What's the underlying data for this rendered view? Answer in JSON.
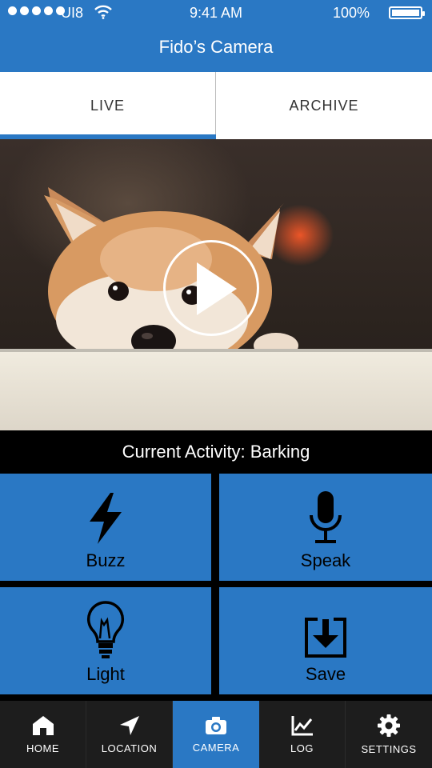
{
  "status": {
    "carrier": "UI8",
    "time": "9:41 AM",
    "battery_pct": "100%",
    "battery_level": 1.0
  },
  "header": {
    "title": "Fido’s Camera"
  },
  "tabs": [
    {
      "label": "LIVE",
      "active": true
    },
    {
      "label": "ARCHIVE",
      "active": false
    }
  ],
  "activity": {
    "text": "Current Activity: Barking"
  },
  "actions": [
    {
      "label": "Buzz",
      "icon": "lightning-icon"
    },
    {
      "label": "Speak",
      "icon": "microphone-icon"
    },
    {
      "label": "Light",
      "icon": "lightbulb-icon"
    },
    {
      "label": "Save",
      "icon": "save-download-icon"
    }
  ],
  "nav": {
    "items": [
      {
        "label": "HOME",
        "icon": "home-icon",
        "active": false
      },
      {
        "label": "LOCATION",
        "icon": "location-arrow-icon",
        "active": false
      },
      {
        "label": "CAMERA",
        "icon": "camera-icon",
        "active": true
      },
      {
        "label": "LOG",
        "icon": "chart-line-icon",
        "active": false
      },
      {
        "label": "SETTINGS",
        "icon": "gear-icon",
        "active": false
      }
    ]
  },
  "colors": {
    "accent": "#2a78c4",
    "nav_bg": "#1d1d1d"
  }
}
